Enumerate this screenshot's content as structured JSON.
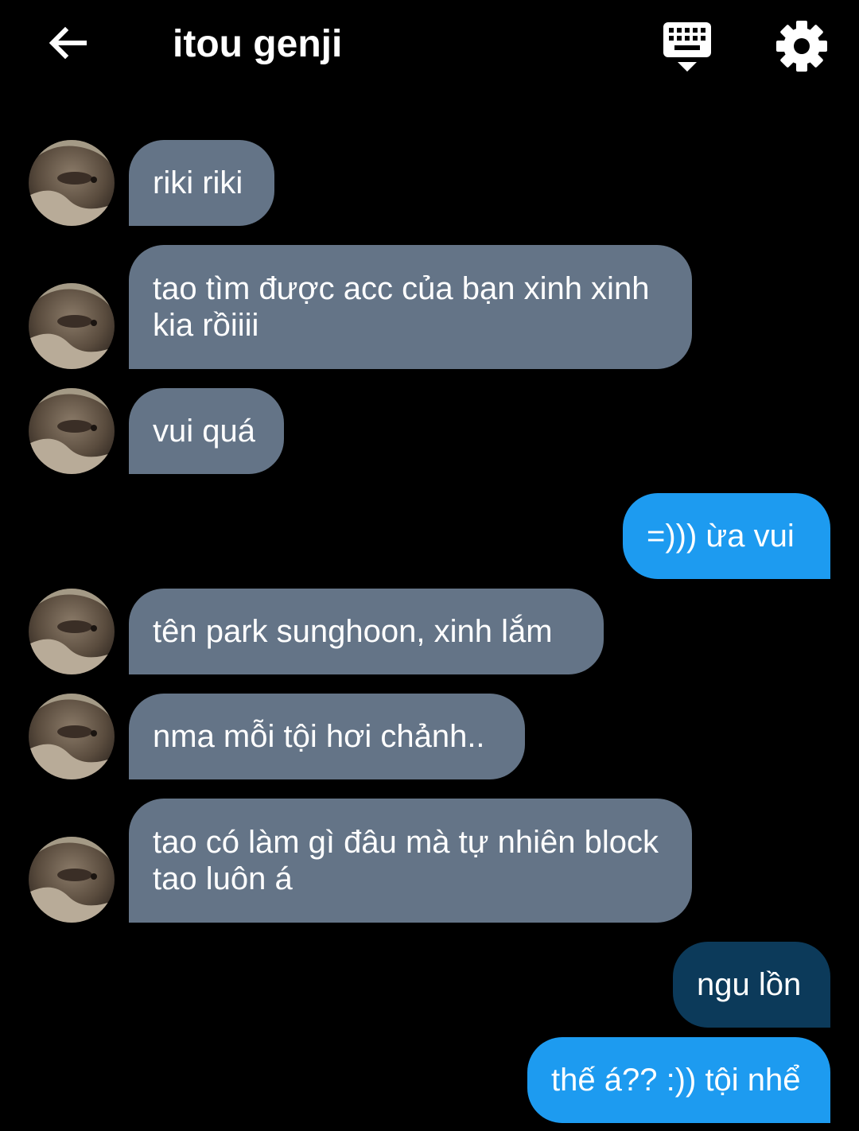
{
  "header": {
    "title": "itou genji",
    "back_icon": "arrow-left-icon",
    "keyboard_icon": "keyboard-hide-icon",
    "settings_icon": "gear-icon"
  },
  "colors": {
    "background": "#000000",
    "received_bubble": "#647487",
    "sent_bubble": "#1d9bf0",
    "sent_bubble_pressed": "#0c3a5a"
  },
  "messages": [
    {
      "sender": "contact",
      "text": "riki riki"
    },
    {
      "sender": "contact",
      "text": "tao tìm được acc của bạn xinh xinh kia rồiiii"
    },
    {
      "sender": "contact",
      "text": "vui quá"
    },
    {
      "sender": "me",
      "text": "=))) ừa vui"
    },
    {
      "sender": "contact",
      "text": "tên park sunghoon, xinh lắm"
    },
    {
      "sender": "contact",
      "text": "nma mỗi tội hơi chảnh.."
    },
    {
      "sender": "contact",
      "text": "tao có làm gì đâu mà tự nhiên block tao luôn á"
    },
    {
      "sender": "me",
      "text": "ngu lồn"
    },
    {
      "sender": "me",
      "text": "thế á?? :)) tội nhể"
    }
  ]
}
